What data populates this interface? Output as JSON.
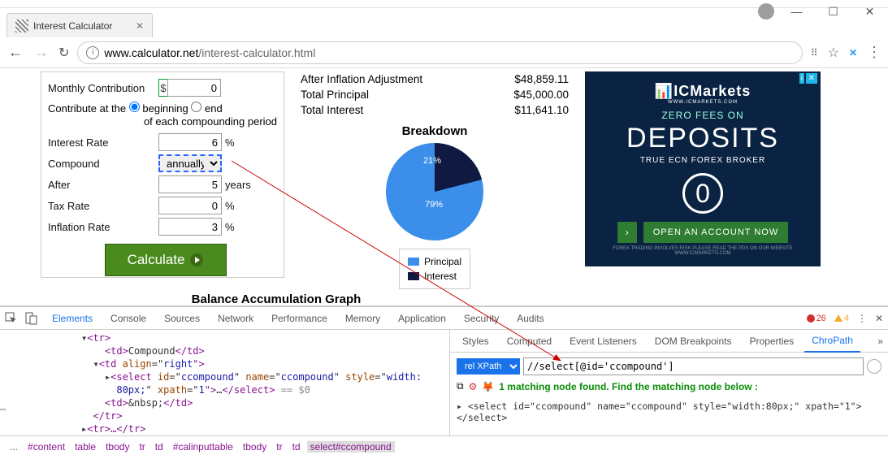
{
  "window": {
    "title": "Interest Calculator"
  },
  "url": {
    "host": "www.calculator.net",
    "path": "/interest-calculator.html"
  },
  "form": {
    "monthly_contribution_label": "Monthly Contribution",
    "monthly_contribution_value": "0",
    "contribute_line": "Contribute at the",
    "contribute_opt1": "beginning",
    "contribute_opt2": "end",
    "contribute_suffix": "of each compounding period",
    "interest_rate_label": "Interest Rate",
    "interest_rate_value": "6",
    "compound_label": "Compound",
    "compound_value": "annually",
    "after_label": "After",
    "after_value": "5",
    "after_unit": "years",
    "tax_rate_label": "Tax Rate",
    "tax_rate_value": "0",
    "inflation_rate_label": "Inflation Rate",
    "inflation_rate_value": "3",
    "percent": "%",
    "dollar": "$",
    "calculate": "Calculate"
  },
  "results": {
    "row1_label": "After Inflation Adjustment",
    "row1_value": "$48,859.11",
    "row2_label": "Total Principal",
    "row2_value": "$45,000.00",
    "row3_label": "Total Interest",
    "row3_value": "$11,641.10",
    "breakdown_title": "Breakdown",
    "graph_title": "Balance Accumulation Graph"
  },
  "chart_data": {
    "type": "pie",
    "series": [
      {
        "name": "Principal",
        "value": 79,
        "color": "#3b8eea"
      },
      {
        "name": "Interest",
        "value": 21,
        "color": "#101942"
      }
    ],
    "labels": [
      "79%",
      "21%"
    ],
    "legend": [
      "Principal",
      "Interest"
    ]
  },
  "ad": {
    "brand": "ICMarkets",
    "brand_sub": "WWW.ICMARKETS.COM",
    "line1": "ZERO FEES ON",
    "headline": "DEPOSITS",
    "line2": "TRUE ECN FOREX BROKER",
    "cta": "OPEN AN ACCOUNT NOW",
    "zero": "0",
    "disclaimer": "FOREX TRADING INVOLVES RISK PLEASE READ THE PDS ON OUR WEBSITE WWW.ICMARKETS.COM"
  },
  "devtools": {
    "tabs": [
      "Elements",
      "Console",
      "Sources",
      "Network",
      "Performance",
      "Memory",
      "Application",
      "Security",
      "Audits"
    ],
    "active_tab": "Elements",
    "errors": "26",
    "warnings": "4",
    "dom_lines": {
      "l1": "<tr>",
      "l2a": "<td>",
      "l2b": "Compound",
      "l2c": "</td>",
      "l3a": "<td ",
      "l3b": "align",
      "l3c": "=\"",
      "l3d": "right",
      "l3e": "\">",
      "l4a": "<select ",
      "l4b": "id",
      "l4c": "=\"",
      "l4d": "ccompound",
      "l4e": "\" ",
      "l4f": "name",
      "l4g": "=\"",
      "l4h": "ccompound",
      "l4i": "\" ",
      "l4j": "style",
      "l4k": "=\"",
      "l4l": "width:",
      "l5a": "80px;",
      "l5b": "\" ",
      "l5c": "xpath",
      "l5d": "=\"",
      "l5e": "1",
      "l5f": "\">",
      "l5g": "…",
      "l5h": "</select>",
      "l5i": " == $0",
      "l6a": "<td>",
      "l6b": "&nbsp;",
      "l6c": "</td>",
      "l7": "</tr>",
      "l8": "<tr>…</tr>"
    },
    "breadcrumb": [
      "...",
      "#content",
      "table",
      "tbody",
      "tr",
      "td",
      "#calinputtable",
      "tbody",
      "tr",
      "td",
      "select#ccompound"
    ],
    "side_tabs": [
      "Styles",
      "Computed",
      "Event Listeners",
      "DOM Breakpoints",
      "Properties",
      "ChroPath"
    ],
    "side_active": "ChroPath",
    "cp_selector_mode": "rel XPath",
    "cp_input": "//select[@id='ccompound']",
    "cp_message": "1 matching node found. Find the matching node below :",
    "cp_result": "<select id=\"ccompound\" name=\"ccompound\" style=\"width:80px;\" xpath=\"1\"></select>"
  }
}
